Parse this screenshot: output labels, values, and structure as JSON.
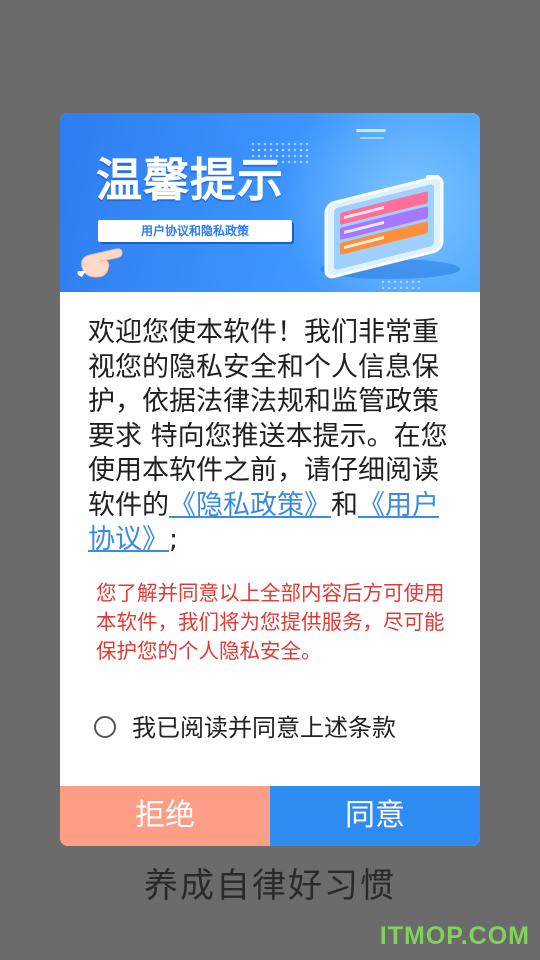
{
  "dialog": {
    "banner_title": "温馨提示",
    "banner_subtitle": "用户协议和隐私政策",
    "body": {
      "intro": "欢迎您使本软件！我们非常重视您的隐私安全和个人信息保护，依据法律法规和监管政策要求 特向您推送本提示。在您使用本软件之前，请仔细阅读软件的",
      "privacy_link": "《隐私政策》",
      "and": "和",
      "user_link": "《用户协议》",
      "end": ";"
    },
    "notice": "您了解并同意以上全部内容后方可使用本软件，我们将为您提供服务，尽可能保护您的个人隐私安全。",
    "agree_checkbox_label": "我已阅读并同意上述条款",
    "agree_checked": false,
    "reject_button": "拒绝",
    "agree_button": "同意",
    "colors": {
      "banner": "#3d95ff",
      "reject": "#ff9e86",
      "agree": "#2f8cf3",
      "notice": "#e53935",
      "link": "#3b8be0"
    }
  },
  "slogan": "养成自律好习惯",
  "watermark": "ITMOP.COM"
}
